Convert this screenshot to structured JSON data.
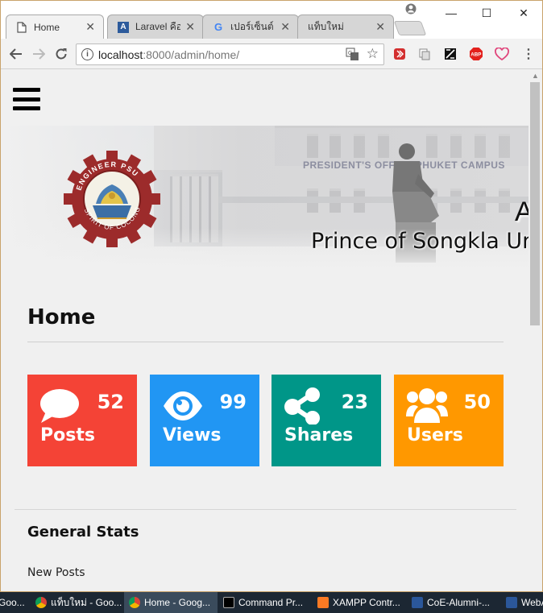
{
  "browser": {
    "tabs": [
      {
        "title": "Home",
        "icon": "page-icon",
        "active": true
      },
      {
        "title": "Laravel คือ",
        "icon": "laravel-icon"
      },
      {
        "title": "เปอร์เซ็นต์ ว",
        "icon": "google-icon"
      },
      {
        "title": "แท็บใหม่",
        "icon": "none"
      }
    ],
    "url_host": "localhost",
    "url_path": ":8000/admin/home/",
    "window_controls": {
      "minimize": "—",
      "maximize": "☐",
      "close": "✕"
    }
  },
  "page": {
    "title": "Home",
    "banner": {
      "sign_text": "PRESIDENT'S OFFICE PHUKET CAMPUS",
      "emblem_top": "ENGINEER PSU",
      "emblem_bottom": "SPIRIT OF COCONG",
      "heading_partial": "A",
      "university": "Prince of Songkla Un"
    },
    "cards": [
      {
        "label": "Posts",
        "value": "52",
        "color": "#f44336",
        "icon": "comment-icon"
      },
      {
        "label": "Views",
        "value": "99",
        "color": "#2196f3",
        "icon": "eye-icon"
      },
      {
        "label": "Shares",
        "value": "23",
        "color": "#009688",
        "icon": "share-icon"
      },
      {
        "label": "Users",
        "value": "50",
        "color": "#ff9800",
        "icon": "users-icon"
      }
    ],
    "section_title": "General Stats",
    "section_item": "New Posts"
  },
  "taskbar": {
    "items": [
      {
        "label": "Goo..."
      },
      {
        "label": "แท็บใหม่ - Goo..."
      },
      {
        "label": "Home - Goog..."
      },
      {
        "label": "Command Pr..."
      },
      {
        "label": "XAMPP Contr..."
      },
      {
        "label": "CoE-Alumni-..."
      },
      {
        "label": "WebA"
      }
    ]
  }
}
